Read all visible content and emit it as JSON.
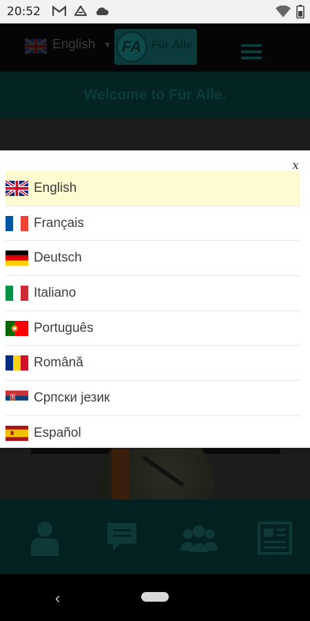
{
  "status_bar": {
    "time": "20:52",
    "left_icons": [
      "gmail-icon",
      "drive-icon",
      "cloud-icon"
    ],
    "right_icons": [
      "wifi-icon",
      "battery-icon"
    ]
  },
  "header": {
    "current_language": "English",
    "logo_monogram": "FA",
    "logo_text": "Für Alle"
  },
  "welcome": {
    "text": "Welcome to Für Alle."
  },
  "bottom_nav": {
    "items": [
      {
        "icon": "person-icon"
      },
      {
        "icon": "chat-icon"
      },
      {
        "icon": "group-icon"
      },
      {
        "icon": "news-icon"
      }
    ]
  },
  "language_modal": {
    "close_label": "x",
    "languages": [
      {
        "label": "English",
        "flag": "uk-flag-icon",
        "selected": true
      },
      {
        "label": "Français",
        "flag": "france-flag-icon",
        "selected": false
      },
      {
        "label": "Deutsch",
        "flag": "germany-flag-icon",
        "selected": false
      },
      {
        "label": "Italiano",
        "flag": "italy-flag-icon",
        "selected": false
      },
      {
        "label": "Português",
        "flag": "portugal-flag-icon",
        "selected": false
      },
      {
        "label": "Română",
        "flag": "romania-flag-icon",
        "selected": false
      },
      {
        "label": "Српски језик",
        "flag": "serbia-flag-icon",
        "selected": false
      },
      {
        "label": "Español",
        "flag": "spain-flag-icon",
        "selected": false
      }
    ]
  },
  "colors": {
    "selected_row": "#fdfbcf",
    "teal_dark": "#042323",
    "teal_accent": "#0b3b3b"
  }
}
